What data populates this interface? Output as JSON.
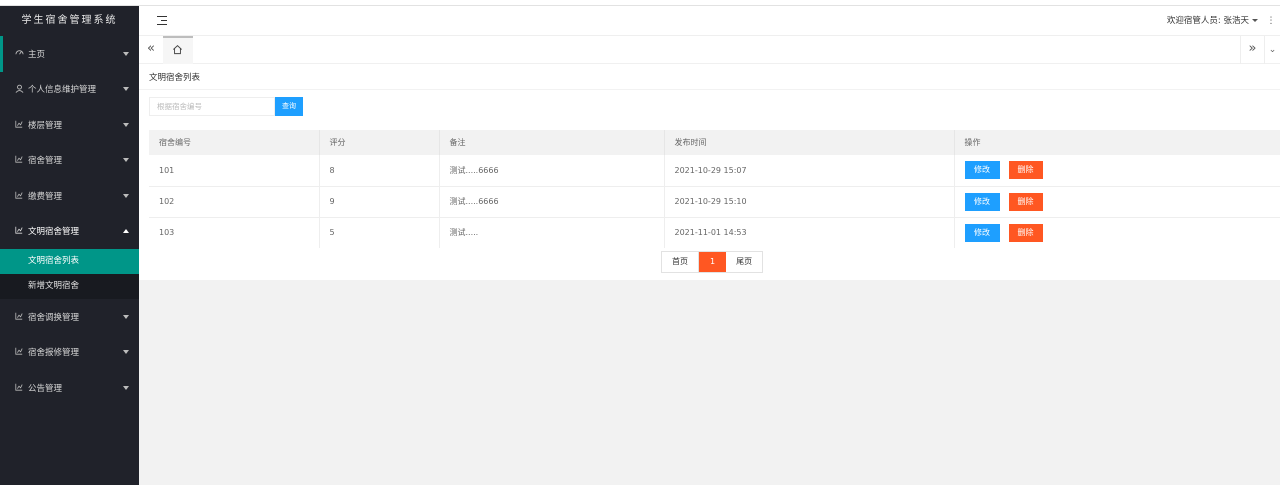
{
  "app": {
    "title": "学生宿舍管理系统"
  },
  "sidebar": {
    "items": [
      {
        "label": "主页",
        "icon": "dashboard-icon"
      },
      {
        "label": "个人信息维护管理",
        "icon": "user-icon"
      },
      {
        "label": "楼层管理",
        "icon": "chart-icon"
      },
      {
        "label": "宿舍管理",
        "icon": "chart-icon"
      },
      {
        "label": "缴费管理",
        "icon": "chart-icon"
      },
      {
        "label": "文明宿舍管理",
        "icon": "chart-icon",
        "expanded": true,
        "children": [
          {
            "label": "文明宿舍列表",
            "selected": true
          },
          {
            "label": "新增文明宿舍"
          }
        ]
      },
      {
        "label": "宿舍调换管理",
        "icon": "chart-icon"
      },
      {
        "label": "宿舍报修管理",
        "icon": "chart-icon"
      },
      {
        "label": "公告管理",
        "icon": "chart-icon"
      }
    ]
  },
  "header": {
    "user_label": "欢迎宿管人员: 张浩天"
  },
  "tabs": {
    "prev_glyph": "«",
    "next_glyph": "»",
    "home_icon": "home-icon"
  },
  "main": {
    "heading": "文明宿舍列表",
    "search": {
      "placeholder": "根据宿舍编号",
      "button": "查询"
    },
    "table": {
      "columns": [
        "宿舍编号",
        "评分",
        "备注",
        "发布时间",
        "操作"
      ],
      "rows": [
        {
          "dorm_no": "101",
          "score": "8",
          "note": "测试.....6666",
          "time": "2021-10-29 15:07"
        },
        {
          "dorm_no": "102",
          "score": "9",
          "note": "测试.....6666",
          "time": "2021-10-29 15:10"
        },
        {
          "dorm_no": "103",
          "score": "5",
          "note": "测试.....",
          "time": "2021-11-01 14:53"
        }
      ],
      "edit_label": "修改",
      "delete_label": "删除"
    },
    "pager": {
      "first": "首页",
      "current": "1",
      "last": "尾页"
    }
  },
  "colors": {
    "sidebar_bg": "#20222a",
    "accent_green": "#009688",
    "primary_blue": "#1e9fff",
    "danger_orange": "#ff5722"
  }
}
